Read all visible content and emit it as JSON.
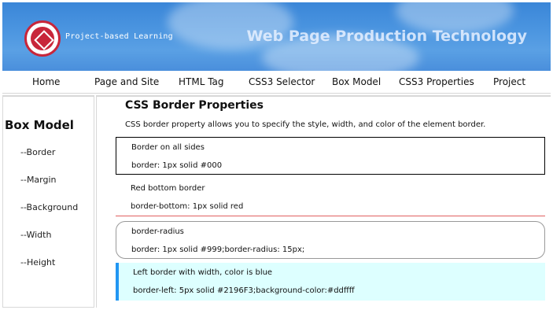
{
  "banner": {
    "subtitle": "Project-based Learning",
    "title": "Web Page Production Technology"
  },
  "nav": {
    "items": [
      "Home",
      "Page and Site",
      "HTML Tag",
      "CSS3 Selector",
      "Box Model",
      "CSS3 Properties",
      "Project"
    ]
  },
  "sidebar": {
    "title": "Box Model",
    "links": [
      "--Border",
      "--Margin",
      "--Background",
      "--Width",
      "--Height"
    ]
  },
  "main": {
    "title": "CSS Border Properties",
    "description": "CSS border property allows you to specify the style, width, and color of the element border.",
    "demos": [
      {
        "label": "Border on all sides",
        "code": "border: 1px solid #000"
      },
      {
        "label": "Red bottom border",
        "code": "border-bottom: 1px solid red"
      },
      {
        "label": "border-radius",
        "code": "border: 1px solid #999;border-radius: 15px;"
      },
      {
        "label": "Left border with width, color is blue",
        "code": "border-left: 5px solid #2196F3;background-color:#ddffff"
      }
    ]
  },
  "colors": {
    "banner_blue": "#4a8fdc",
    "logo_red": "#c8263a",
    "accent_blue": "#2196F3",
    "demo_bg": "#ddffff",
    "red_border": "#e06060"
  }
}
